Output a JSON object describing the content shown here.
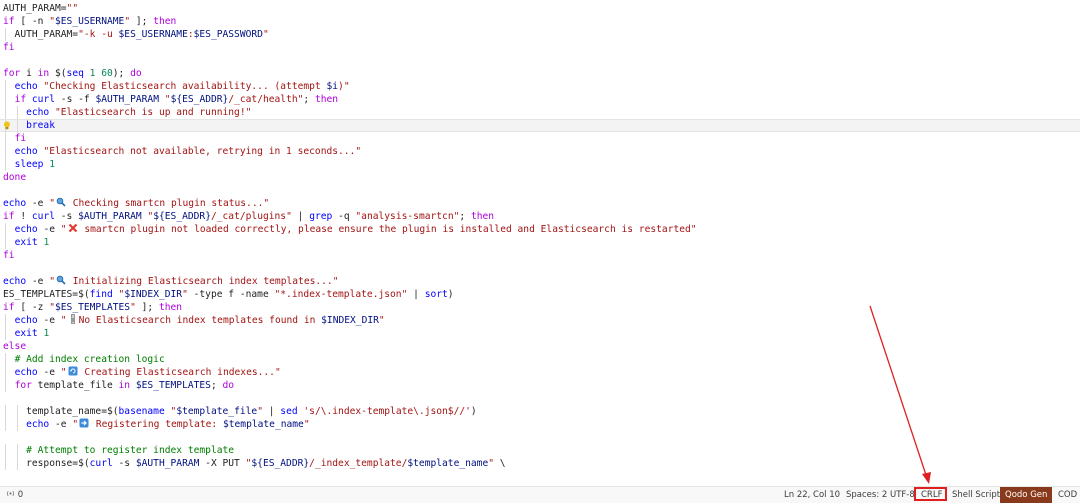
{
  "editor": {
    "lines": [
      "AUTH_PARAM=\"\"",
      "if [ -n \"$ES_USERNAME\" ]; then",
      "  AUTH_PARAM=\"-k -u $ES_USERNAME:$ES_PASSWORD\"",
      "fi",
      "",
      "for i in $(seq 1 60); do",
      "  echo \"Checking Elasticsearch availability... (attempt $i)\"",
      "  if curl -s -f $AUTH_PARAM \"${ES_ADDR}/_cat/health\"; then",
      "    echo \"Elasticsearch is up and running!\"",
      "    break",
      "  fi",
      "  echo \"Elasticsearch not available, retrying in 1 seconds...\"",
      "  sleep 1",
      "done",
      "",
      "echo -e \"{ICON} Checking smartcn plugin status...\"",
      "if ! curl -s $AUTH_PARAM \"${ES_ADDR}/_cat/plugins\" | grep -q \"analysis-smartcn\"; then",
      "  echo -e \"{ICON} smartcn plugin not loaded correctly, please ensure the plugin is installed and Elasticsearch is restarted\"",
      "  exit 1",
      "fi",
      "",
      "echo -e \"{ICON} Initializing Elasticsearch index templates...\"",
      "ES_TEMPLATES=$(find \"$INDEX_DIR\" -type f -name \"*.index-template.json\" | sort)",
      "if [ -z \"$ES_TEMPLATES\" ]; then",
      "  echo -e \"{ICON}No Elasticsearch index templates found in $INDEX_DIR\"",
      "  exit 1",
      "else",
      "  # Add index creation logic",
      "  echo -e \"{ICON} Creating Elasticsearch indexes...\"",
      "  for template_file in $ES_TEMPLATES; do",
      "",
      "    template_name=$(basename \"$template_file\" | sed 's/\\.index-template\\.json$//')",
      "    echo -e \"{ICON} Registering template: $template_name\"",
      "",
      "    # Attempt to register index template",
      "    response=$(curl -s $AUTH_PARAM -X PUT \"${ES_ADDR}/_index_template/$template_name\" \\"
    ],
    "icons": {
      "15": "magnifier-icon",
      "17": "cross-mark-icon",
      "21": "magnifier-icon",
      "24": "info-icon",
      "28": "refresh-icon",
      "32": "arrow-right-icon"
    },
    "highlighted_line_index": 9,
    "lightbulb_line_index": 9
  },
  "statusbar": {
    "ports": "0",
    "cursor_position": "Ln 22, Col 10",
    "indentation": "Spaces: 2",
    "encoding": "UTF-8",
    "eol": "CRLF",
    "language": "Shell Script",
    "qodo": "Qodo Gen",
    "overflow": "COD"
  },
  "colors": {
    "qodo_bg": "#8a3a1c",
    "annotation_red": "#e02020"
  }
}
